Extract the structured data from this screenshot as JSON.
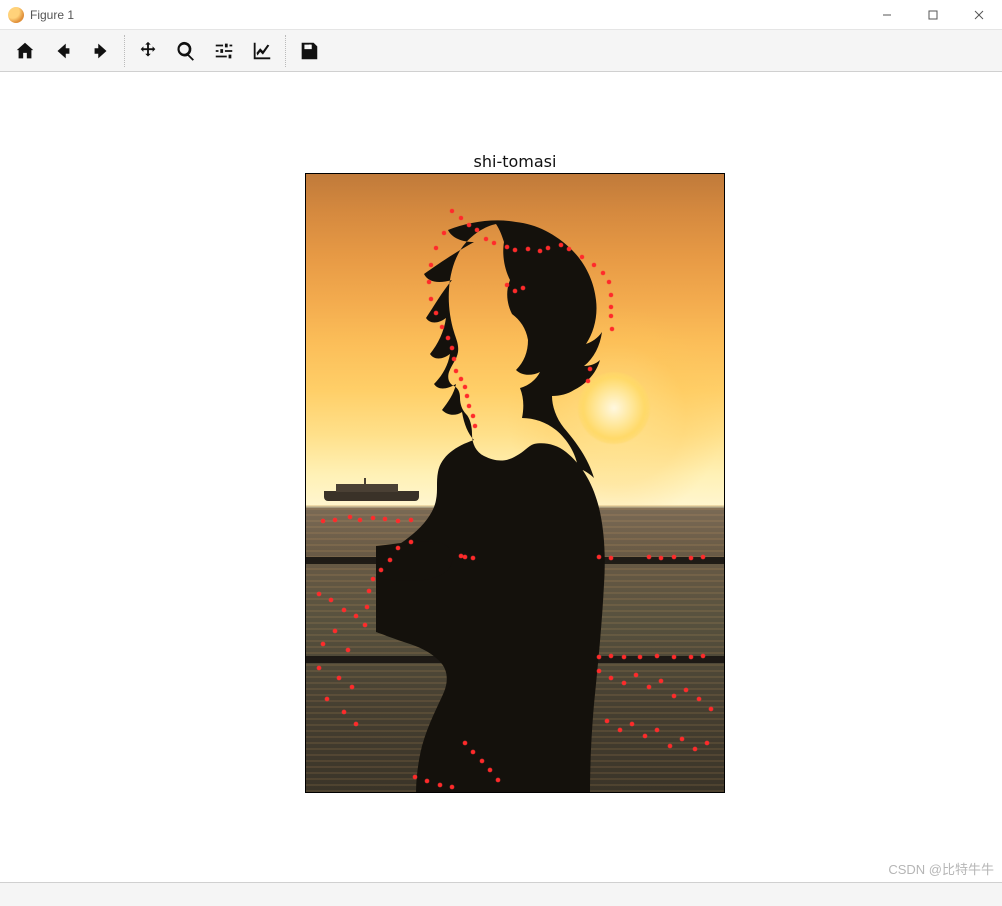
{
  "window": {
    "title": "Figure 1",
    "controls": {
      "minimize": "minimize",
      "maximize": "maximize",
      "close": "close"
    }
  },
  "toolbar": {
    "home": "home-icon",
    "back": "back-icon",
    "forward": "forward-icon",
    "pan": "move-icon",
    "zoom": "zoom-icon",
    "subplots": "sliders-icon",
    "axes": "axes-icon",
    "save": "save-icon"
  },
  "figure": {
    "title": "shi-tomasi",
    "feature_color": "#ff2a2a",
    "points_pct": [
      [
        35,
        6
      ],
      [
        37,
        7.2
      ],
      [
        39,
        8.3
      ],
      [
        41,
        9.1
      ],
      [
        43,
        10.5
      ],
      [
        45,
        11.2
      ],
      [
        48,
        11.8
      ],
      [
        50,
        12.3
      ],
      [
        53,
        12.1
      ],
      [
        56,
        12.4
      ],
      [
        58,
        12.0
      ],
      [
        61,
        11.5
      ],
      [
        63,
        12.2
      ],
      [
        66,
        13.5
      ],
      [
        69,
        14.8
      ],
      [
        71,
        16.0
      ],
      [
        33,
        9.5
      ],
      [
        31,
        12.0
      ],
      [
        30,
        14.8
      ],
      [
        29.5,
        17.5
      ],
      [
        29.8,
        20.2
      ],
      [
        31,
        22.5
      ],
      [
        32.5,
        24.8
      ],
      [
        34,
        26.5
      ],
      [
        35,
        28.2
      ],
      [
        35.5,
        30.0
      ],
      [
        36,
        31.8
      ],
      [
        37,
        33.2
      ],
      [
        38,
        34.5
      ],
      [
        38.5,
        36.0
      ],
      [
        39,
        37.5
      ],
      [
        40,
        39.2
      ],
      [
        40.5,
        40.8
      ],
      [
        72.5,
        17.5
      ],
      [
        73,
        19.5
      ],
      [
        73,
        21.5
      ],
      [
        73,
        23.0
      ],
      [
        73.2,
        25.0
      ],
      [
        48,
        18
      ],
      [
        50,
        19
      ],
      [
        52,
        18.5
      ],
      [
        68,
        31.5
      ],
      [
        67.5,
        33.5
      ],
      [
        10.5,
        55.5
      ],
      [
        13,
        56
      ],
      [
        16,
        55.7
      ],
      [
        19,
        55.9
      ],
      [
        22,
        56.2
      ],
      [
        25,
        56.0
      ],
      [
        4,
        56.2
      ],
      [
        7,
        56.0
      ],
      [
        25,
        59.5
      ],
      [
        22,
        60.5
      ],
      [
        20,
        62.5
      ],
      [
        18,
        64.0
      ],
      [
        16,
        65.5
      ],
      [
        15,
        67.5
      ],
      [
        14.5,
        70
      ],
      [
        14,
        73
      ],
      [
        37,
        61.8
      ],
      [
        38,
        62.0
      ],
      [
        40,
        62.1
      ],
      [
        70,
        62.0
      ],
      [
        73,
        62.1
      ],
      [
        82,
        62.0
      ],
      [
        85,
        62.1
      ],
      [
        88,
        62.0
      ],
      [
        92,
        62.1
      ],
      [
        95,
        62.0
      ],
      [
        3,
        68
      ],
      [
        6,
        69
      ],
      [
        9,
        70.5
      ],
      [
        12,
        71.5
      ],
      [
        7,
        74
      ],
      [
        4,
        76
      ],
      [
        10,
        77
      ],
      [
        3,
        80
      ],
      [
        8,
        81.5
      ],
      [
        11,
        83
      ],
      [
        5,
        85
      ],
      [
        9,
        87
      ],
      [
        12,
        89
      ],
      [
        70,
        78.1
      ],
      [
        73,
        78.0
      ],
      [
        76,
        78.2
      ],
      [
        80,
        78.1
      ],
      [
        84,
        78.0
      ],
      [
        88,
        78.2
      ],
      [
        92,
        78.1
      ],
      [
        95,
        78.0
      ],
      [
        70,
        80.5
      ],
      [
        73,
        81.5
      ],
      [
        76,
        82.3
      ],
      [
        79,
        81.0
      ],
      [
        82,
        83.0
      ],
      [
        85,
        82.0
      ],
      [
        88,
        84.5
      ],
      [
        91,
        83.5
      ],
      [
        94,
        85.0
      ],
      [
        97,
        86.5
      ],
      [
        72,
        88.5
      ],
      [
        75,
        90.0
      ],
      [
        78,
        89.0
      ],
      [
        81,
        91.0
      ],
      [
        84,
        90.0
      ],
      [
        87,
        92.5
      ],
      [
        90,
        91.5
      ],
      [
        93,
        93.0
      ],
      [
        96,
        92.0
      ],
      [
        38,
        92.0
      ],
      [
        40,
        93.5
      ],
      [
        42,
        95.0
      ],
      [
        44,
        96.5
      ],
      [
        46,
        98.0
      ],
      [
        26,
        97.5
      ],
      [
        29,
        98.2
      ],
      [
        32,
        98.8
      ],
      [
        35,
        99.2
      ]
    ]
  },
  "watermark": "CSDN @比特牛牛"
}
